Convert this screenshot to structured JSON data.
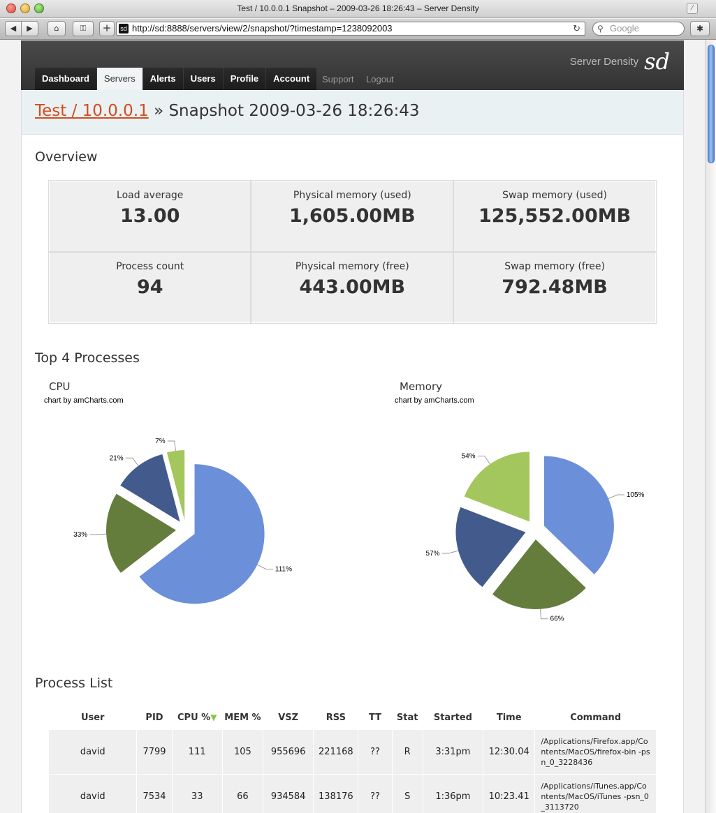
{
  "window": {
    "title": "Test / 10.0.0.1 Snapshot – 2009-03-26 18:26:43 – Server Density"
  },
  "toolbar": {
    "url": "http://sd:8888/servers/view/2/snapshot/?timestamp=1238092003",
    "search_placeholder": "Google"
  },
  "nav": {
    "items": [
      {
        "label": "Dashboard"
      },
      {
        "label": "Servers"
      },
      {
        "label": "Alerts"
      },
      {
        "label": "Users"
      },
      {
        "label": "Profile"
      },
      {
        "label": "Account"
      }
    ],
    "active": "Servers",
    "support": "Support",
    "logout": "Logout"
  },
  "brand": {
    "name": "Server Density"
  },
  "page": {
    "crumb": "Test / 10.0.0.1",
    "title_rest": " » Snapshot 2009-03-26 18:26:43"
  },
  "overview": {
    "heading": "Overview",
    "metrics": [
      {
        "label": "Load average",
        "value": "13.00"
      },
      {
        "label": "Physical memory (used)",
        "value": "1,605.00MB"
      },
      {
        "label": "Swap memory (used)",
        "value": "125,552.00MB"
      },
      {
        "label": "Process count",
        "value": "94"
      },
      {
        "label": "Physical memory (free)",
        "value": "443.00MB"
      },
      {
        "label": "Swap memory (free)",
        "value": "792.48MB"
      }
    ]
  },
  "processes": {
    "heading": "Top 4 Processes",
    "credit": "chart by amCharts.com"
  },
  "chart_data": [
    {
      "type": "pie",
      "title": "CPU",
      "values": [
        111,
        33,
        21,
        7
      ],
      "labels": [
        "111%",
        "33%",
        "21%",
        "7%"
      ],
      "colors": [
        "#6b8fd8",
        "#657d3c",
        "#435b8c",
        "#a4c75d"
      ]
    },
    {
      "type": "pie",
      "title": "Memory",
      "values": [
        105,
        66,
        57,
        54
      ],
      "labels": [
        "105%",
        "66%",
        "57%",
        "54%"
      ],
      "colors": [
        "#6b8fd8",
        "#657d3c",
        "#435b8c",
        "#a4c75d"
      ]
    }
  ],
  "process_list": {
    "heading": "Process List",
    "columns": [
      "User",
      "PID",
      "CPU %",
      "MEM %",
      "VSZ",
      "RSS",
      "TT",
      "Stat",
      "Started",
      "Time",
      "Command"
    ],
    "rows": [
      [
        "david",
        "7799",
        "111",
        "105",
        "955696",
        "221168",
        "??",
        "R",
        "3:31pm",
        "12:30.04",
        "/Applications/Firefox.app/Contents/MacOS/firefox-bin -psn_0_3228436"
      ],
      [
        "david",
        "7534",
        "33",
        "66",
        "934584",
        "138176",
        "??",
        "S",
        "1:36pm",
        "10:23.41",
        "/Applications/iTunes.app/Contents/MacOS/iTunes -psn_0_3113720"
      ]
    ]
  }
}
